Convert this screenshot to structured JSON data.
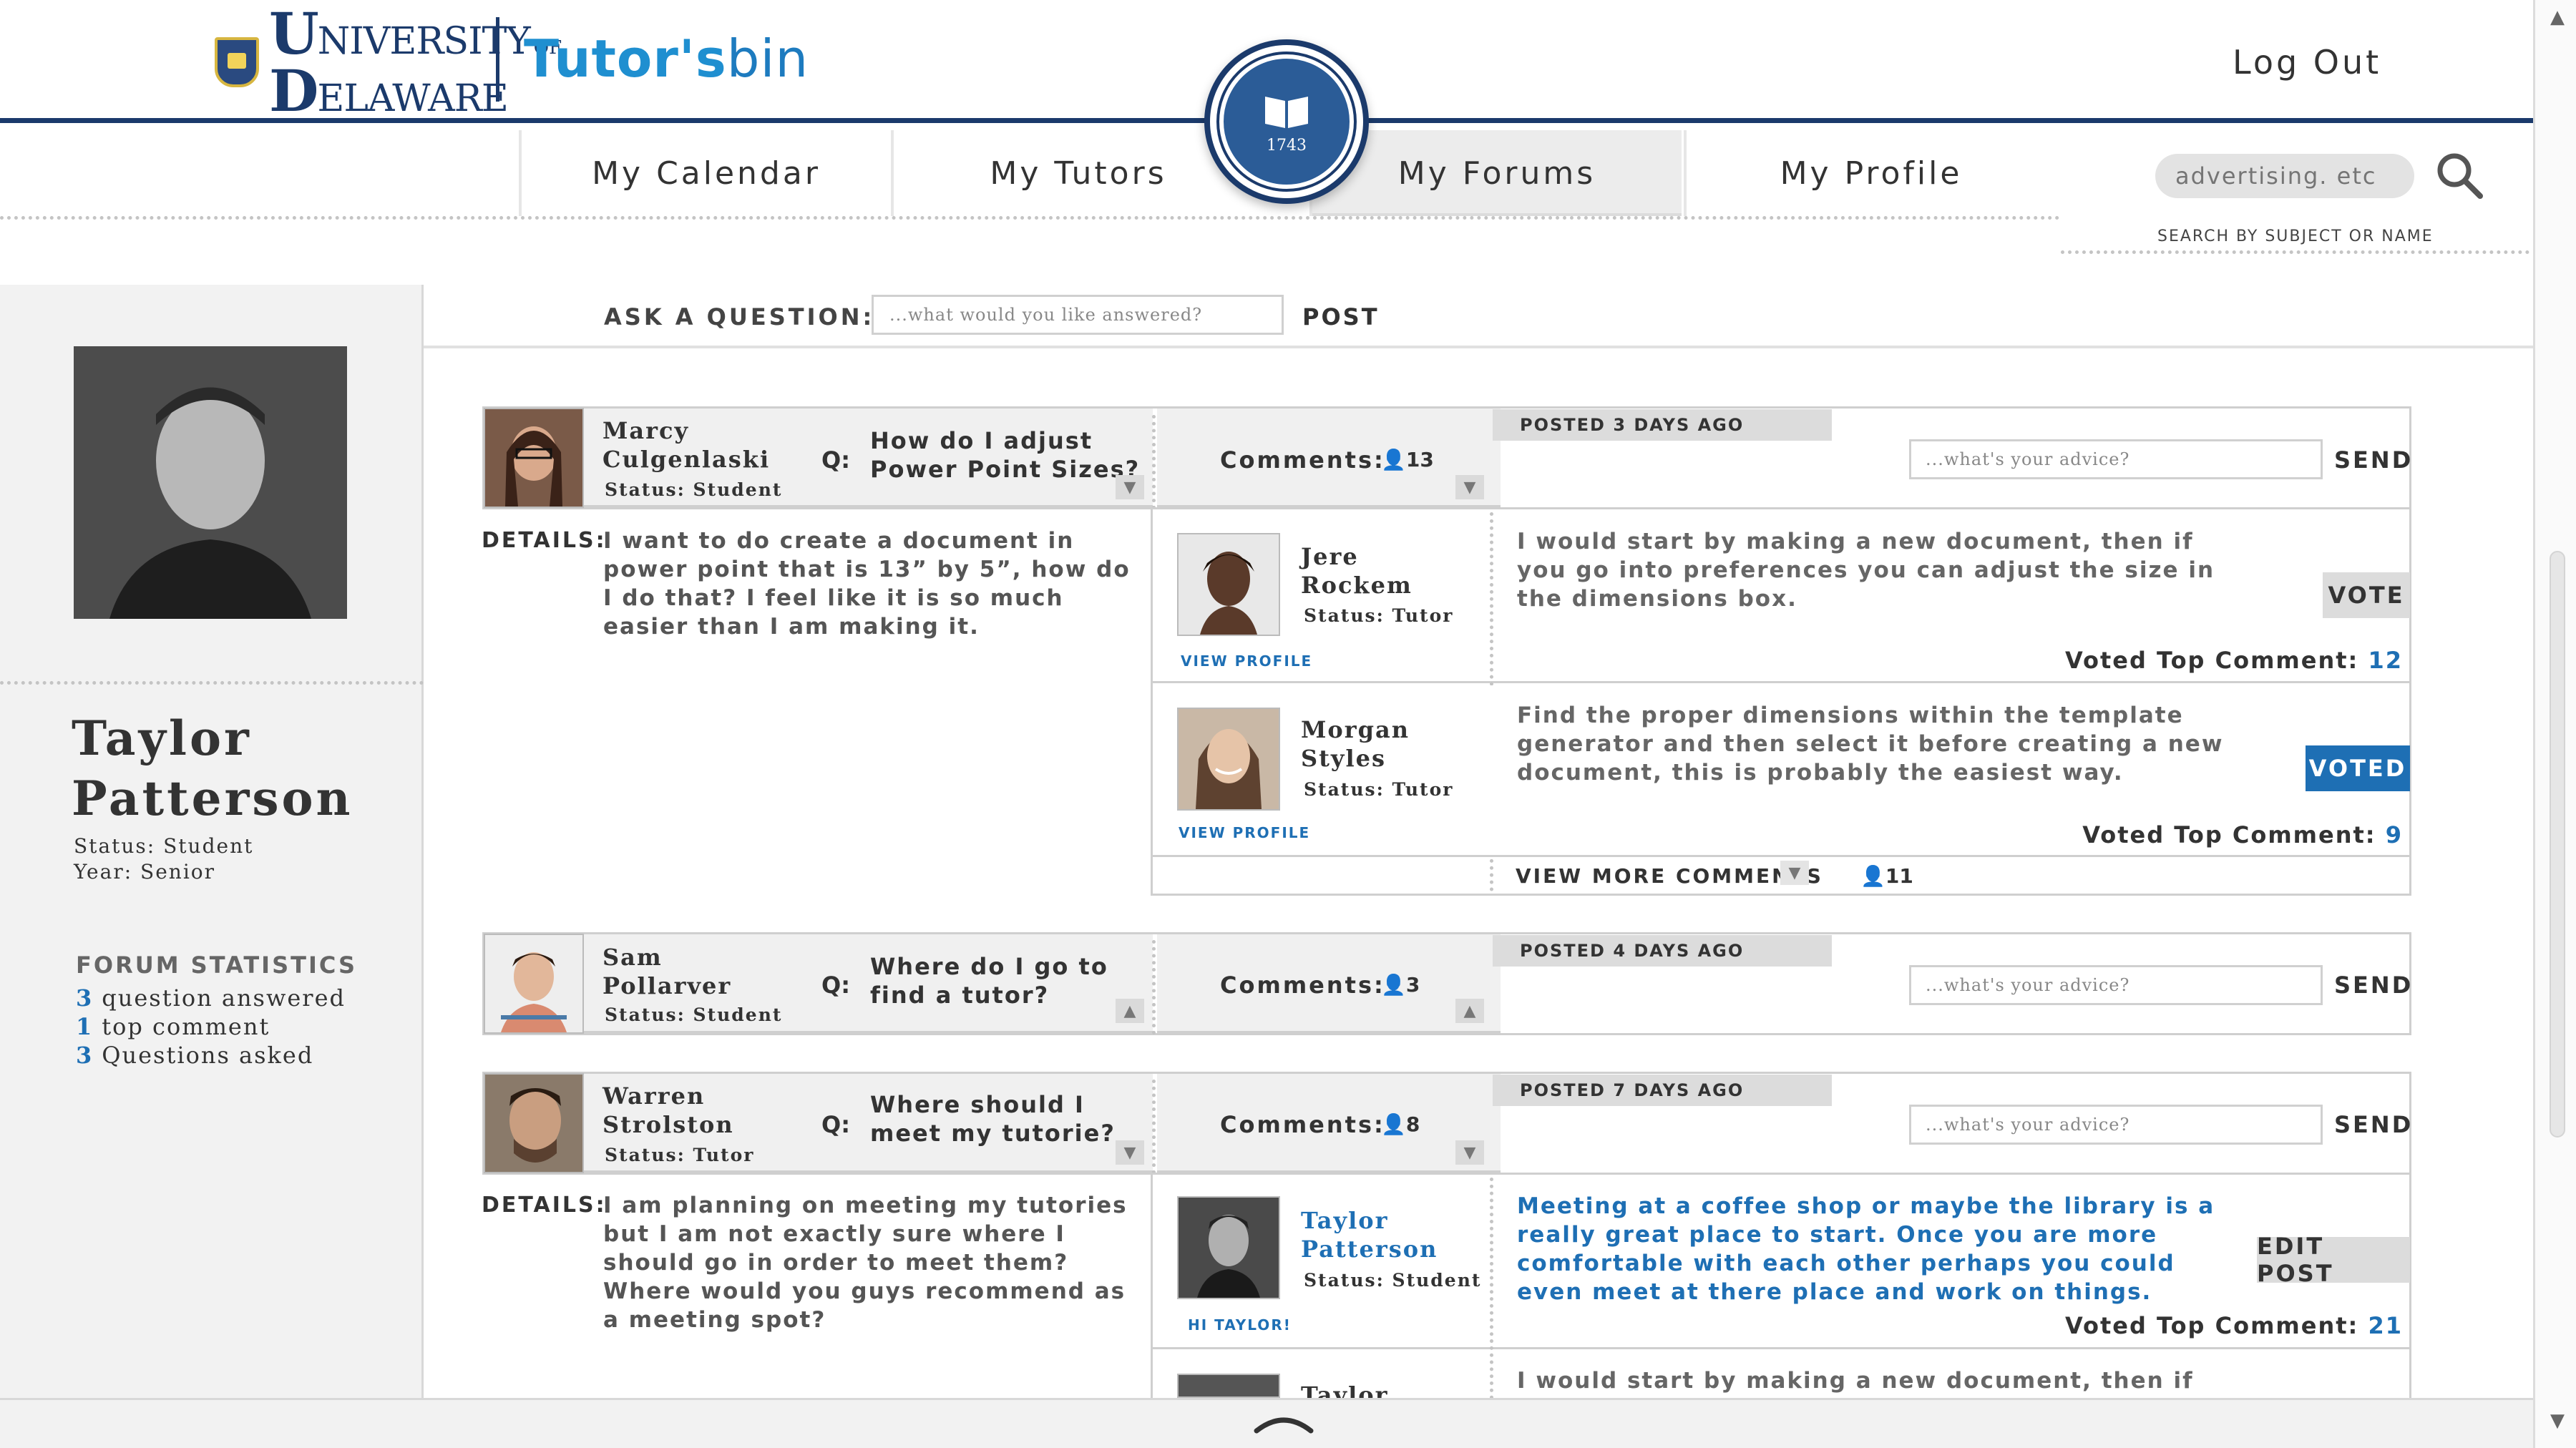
{
  "header": {
    "university_logo": {
      "big_u": "U",
      "line1": "NIVERSITY",
      "of": "OF",
      "big_d": "D",
      "line2": "ELAWARE"
    },
    "tutors_logo": {
      "bold": "Tutor's",
      "light": "bin"
    },
    "logout_label": "Log Out",
    "seal_text": "1743"
  },
  "nav": {
    "items": [
      {
        "label": "My Calendar"
      },
      {
        "label": "My Tutors"
      },
      {
        "label": "My Forums",
        "active": true
      },
      {
        "label": "My Profile"
      }
    ]
  },
  "search": {
    "placeholder": "advertising. etc",
    "caption": "SEARCH BY SUBJECT OR NAME"
  },
  "sidebar": {
    "name": "Taylor Patterson",
    "status": "Status: Student",
    "year": "Year: Senior",
    "stats_title": "FORUM STATISTICS",
    "stats": [
      {
        "n": "3",
        "label": "question answered"
      },
      {
        "n": "1",
        "label": "top comment"
      },
      {
        "n": "3",
        "label": "Questions asked"
      }
    ]
  },
  "ask": {
    "label": "ASK A QUESTION:",
    "placeholder": "...what would you like answered?",
    "post_label": "POST"
  },
  "posts": [
    {
      "name_line1": "Marcy",
      "name_line2": "Culgenlaski",
      "status": "Status: Student",
      "q_label": "Q:",
      "q_line1": "How do I adjust",
      "q_line2": "Power Point Sizes?",
      "comments_label": "Comments:",
      "comments_count": "13",
      "posted": "POSTED 3 DAYS AGO",
      "advice_placeholder": "...what's your advice?",
      "send_label": "SEND",
      "details_label": "DETAILS:",
      "details": "I want to do create a document in power point that is 13” by 5”, how do I do that? I feel like it is so much easier than I am making it.",
      "comments": [
        {
          "name_line1": "Jere",
          "name_line2": "Rockem",
          "status": "Status: Tutor",
          "link": "VIEW PROFILE",
          "text": "I would start by making a new document, then if you go into preferences you can adjust the size in the dimensions box.",
          "button": "VOTE",
          "top_label": "Voted Top Comment:",
          "top_n": "12"
        },
        {
          "name_line1": "Morgan",
          "name_line2": "Styles",
          "status": "Status: Tutor",
          "link": "VIEW PROFILE",
          "text": "Find the proper dimensions within the template generator and then select it before creating a new document, this is probably the easiest way.",
          "button": "VOTED",
          "top_label": "Voted Top Comment:",
          "top_n": "9"
        }
      ],
      "view_more": "VIEW MORE COMMENTS",
      "more_count": "11"
    },
    {
      "name_line1": "Sam",
      "name_line2": "Pollarver",
      "status": "Status: Student",
      "q_label": "Q:",
      "q_line1": "Where do I go to",
      "q_line2": "find a tutor?",
      "comments_label": "Comments:",
      "comments_count": "3",
      "posted": "POSTED 4 DAYS AGO",
      "advice_placeholder": "...what's your advice?",
      "send_label": "SEND"
    },
    {
      "name_line1": "Warren",
      "name_line2": "Strolston",
      "status": "Status: Tutor",
      "q_label": "Q:",
      "q_line1": "Where should I",
      "q_line2": "meet my tutorie?",
      "comments_label": "Comments:",
      "comments_count": "8",
      "posted": "POSTED 7 DAYS AGO",
      "advice_placeholder": "...what's your advice?",
      "send_label": "SEND",
      "details_label": "DETAILS:",
      "details": "I am planning on meeting my tutories but I am not exactly sure where I should go in order to meet them? Where would you guys recommend as a meeting spot?",
      "comments": [
        {
          "name_line1": "Taylor",
          "name_line2": "Patterson",
          "status": "Status: Student",
          "link": "HI TAYLOR!",
          "text": "Meeting at a coffee shop or maybe the library is a really great  place to start. Once you are more comfortable with each other perhaps you could even meet at there place and work on things.",
          "button": "EDIT POST",
          "top_label": "Voted Top Comment:",
          "top_n": "21"
        },
        {
          "name_line1": "Taylor",
          "text": "I would start by making a new document, then if you go"
        }
      ]
    }
  ],
  "colors": {
    "accent": "#1e6fb4",
    "navy": "#1b3a6b",
    "brand": "#1f8fd0"
  },
  "icons": [
    "search-icon",
    "user-icon",
    "chevron-down-icon",
    "chevron-up-icon"
  ]
}
